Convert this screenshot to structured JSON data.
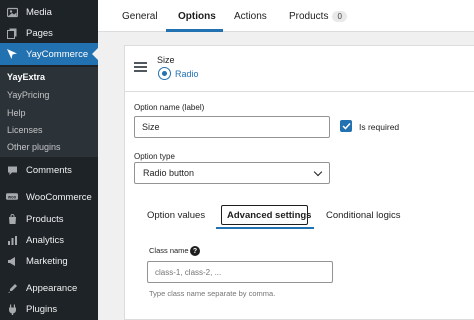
{
  "sidebar": {
    "items": [
      {
        "name": "media",
        "label": "Media",
        "icon": "media-icon"
      },
      {
        "name": "pages",
        "label": "Pages",
        "icon": "pages-icon"
      },
      {
        "name": "yaycommerce",
        "label": "YayCommerce",
        "icon": "yaycommerce-icon"
      },
      {
        "name": "comments",
        "label": "Comments",
        "icon": "comments-icon"
      },
      {
        "name": "woocommerce",
        "label": "WooCommerce",
        "icon": "woocommerce-icon"
      },
      {
        "name": "products",
        "label": "Products",
        "icon": "products-icon"
      },
      {
        "name": "analytics",
        "label": "Analytics",
        "icon": "analytics-icon"
      },
      {
        "name": "marketing",
        "label": "Marketing",
        "icon": "marketing-icon"
      },
      {
        "name": "appearance",
        "label": "Appearance",
        "icon": "appearance-icon"
      },
      {
        "name": "plugins",
        "label": "Plugins",
        "icon": "plugins-icon"
      }
    ],
    "submenu": [
      "YayExtra",
      "YayPricing",
      "Help",
      "Licenses",
      "Other plugins"
    ]
  },
  "tabs": {
    "general": "General",
    "options": "Options",
    "actions": "Actions",
    "products": "Products",
    "products_count": "0"
  },
  "option": {
    "title": "Size",
    "type_badge": "Radio"
  },
  "form": {
    "name_label": "Option name (label)",
    "name_value": "Size",
    "required_label": "Is required",
    "required_checked": true,
    "type_label": "Option type",
    "type_value": "Radio button"
  },
  "subtabs": {
    "values": "Option values",
    "advanced": "Advanced settings",
    "conditional": "Conditional logics"
  },
  "advanced": {
    "class_label": "Class name",
    "class_placeholder": "class-1, class-2, ...",
    "class_hint": "Type class name separate by comma."
  },
  "colors": {
    "accent": "#2271b1",
    "sidebar_bg": "#1d2327"
  }
}
